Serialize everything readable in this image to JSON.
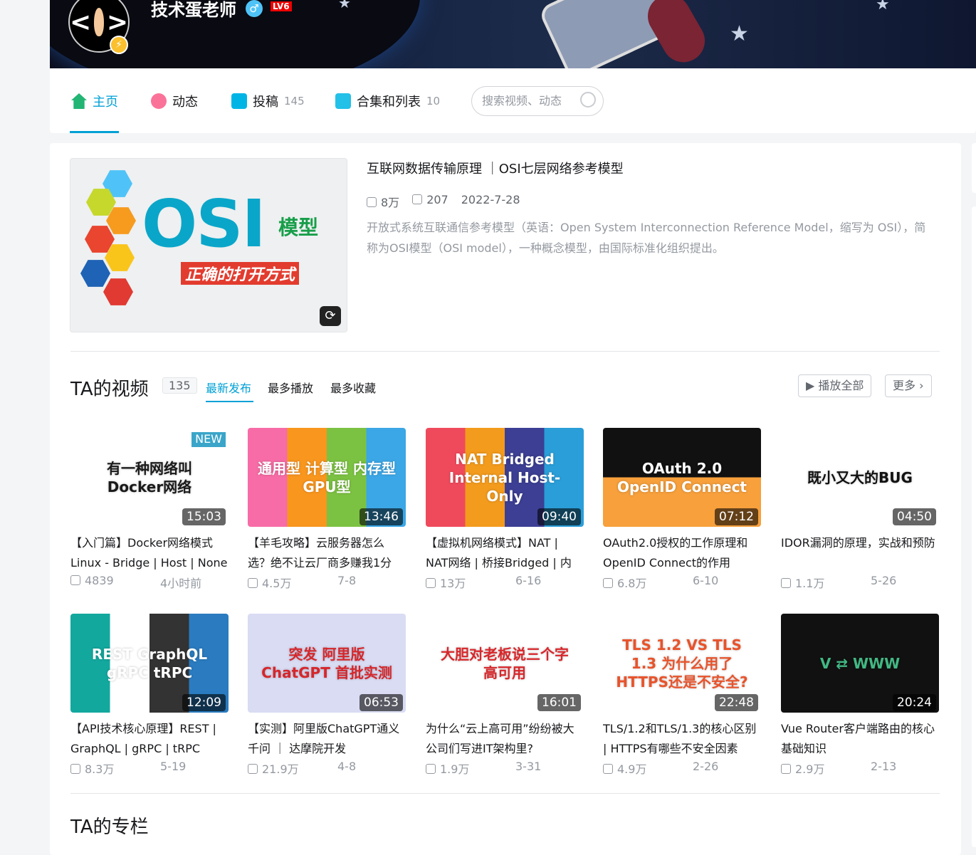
{
  "profile": {
    "name": "技术蛋老师",
    "gender_icon": "♂",
    "level": "LV6"
  },
  "nav": {
    "items": [
      {
        "label": "主页",
        "count": "",
        "color": "#22b573"
      },
      {
        "label": "动态",
        "count": "",
        "color": "#fb7299"
      },
      {
        "label": "投稿",
        "count": "145",
        "color": "#00b5e5"
      },
      {
        "label": "合集和列表",
        "count": "10",
        "color": "#23c0e8"
      }
    ],
    "search_placeholder": "搜索视频、动态"
  },
  "featured": {
    "thumb_main": "OSI",
    "thumb_sub": "模型",
    "thumb_tag": "正确的打开方式",
    "title": "互联网数据传输原理 ｜OSI七层网络参考模型",
    "views": "8万",
    "comments": "207",
    "date": "2022-7-28",
    "desc": "开放式系统互联通信参考模型（英语：Open System Interconnection Reference Model，缩写为 OSI），简称为OSI模型（OSI model），一种概念模型，由国际标准化组织提出。"
  },
  "videos": {
    "heading": "TA的视频",
    "count": "135",
    "tabs": [
      "最新发布",
      "最多播放",
      "最多收藏"
    ],
    "play_all": "播放全部",
    "more": "更多",
    "items": [
      {
        "thumb": "有一种网络叫 Docker网络",
        "bg": "#ffffff",
        "fg": "#1a1a1a",
        "badge": "NEW",
        "duration": "15:03",
        "title": "【入门篇】Docker网络模式 Linux - Bridge | Host | None",
        "views": "4839",
        "date": "4小时前"
      },
      {
        "thumb": "通用型 计算型 内存型 GPU型",
        "bg": "linear-gradient(90deg,#f76ca6 25%,#f9961e 25% 50%,#7cc242 50% 75%,#3ba7e6 75%)",
        "fg": "#fff",
        "badge": "",
        "duration": "13:46",
        "title": "【羊毛攻略】云服务器怎么选？绝不让云厂商多赚我1分",
        "views": "4.5万",
        "date": "7-8"
      },
      {
        "thumb": "NAT Bridged Internal Host-Only",
        "bg": "linear-gradient(90deg,#ef4a5c 25%,#f39b1d 25% 50%,#3c3f93 50% 75%,#2a9ed8 75%)",
        "fg": "#fff",
        "badge": "",
        "duration": "09:40",
        "title": "【虚拟机网络模式】NAT | NAT网络 | 桥接Bridged | 内",
        "views": "13万",
        "date": "6-16"
      },
      {
        "thumb": "OAuth 2.0 OpenID Connect",
        "bg": "linear-gradient(180deg,#111 50%,#f7a03c 50%)",
        "fg": "#fff",
        "badge": "",
        "duration": "07:12",
        "title": "OAuth2.0授权的工作原理和OpenID Connect的作用",
        "views": "6.8万",
        "date": "6-10"
      },
      {
        "thumb": "既小又大的BUG",
        "bg": "#ffffff",
        "fg": "#111",
        "badge": "",
        "duration": "04:50",
        "title": "IDOR漏洞的原理，实战和预防",
        "views": "1.1万",
        "date": "5-26"
      },
      {
        "thumb": "REST GraphQL gRPC tRPC",
        "bg": "linear-gradient(90deg,#13a89e 25%,#fff 25% 50%,#333 50% 75%,#2a7bbf 75%)",
        "fg": "#fff",
        "badge": "",
        "duration": "12:09",
        "title": "【API技术核心原理】REST | GraphQL | gRPC | tRPC",
        "views": "8.3万",
        "date": "5-19"
      },
      {
        "thumb": "突发 阿里版ChatGPT 首批实测",
        "bg": "#d9dcf3",
        "fg": "#d6262b",
        "badge": "",
        "duration": "06:53",
        "title": "【实测】阿里版ChatGPT通义千问 ｜ 达摩院开发",
        "views": "21.9万",
        "date": "4-8"
      },
      {
        "thumb": "大胆对老板说三个字 高可用",
        "bg": "#ffffff",
        "fg": "#d8262a",
        "badge": "",
        "duration": "16:01",
        "title": "为什么“云上高可用”纷纷被大公司们写进IT架构里?",
        "views": "1.9万",
        "date": "3-31"
      },
      {
        "thumb": "TLS 1.2 VS TLS 1.3 为什么用了HTTPS还是不安全?",
        "bg": "#ffffff",
        "fg": "#e8532b",
        "badge": "",
        "duration": "22:48",
        "title": "TLS/1.2和TLS/1.3的核心区别 | HTTPS有哪些不安全因素",
        "views": "4.9万",
        "date": "2-26"
      },
      {
        "thumb": "V ⇄ WWW",
        "bg": "#111111",
        "fg": "#41b883",
        "badge": "",
        "duration": "20:24",
        "title": "Vue Router客户端路由的核心基础知识",
        "views": "2.9万",
        "date": "2-13"
      }
    ]
  },
  "next_section": {
    "heading": "TA的专栏"
  }
}
